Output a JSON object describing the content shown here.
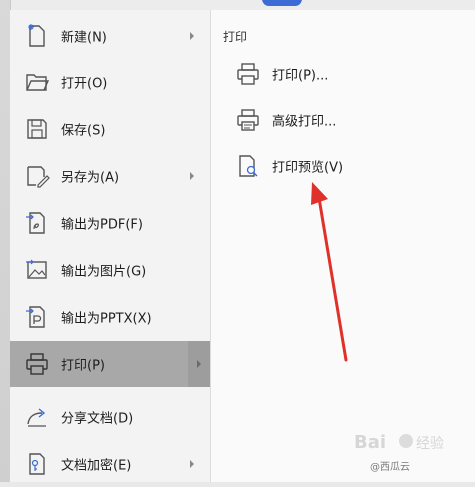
{
  "colors": {
    "menu_bg": "#f3f3f3",
    "active_bg": "#a8a8a8",
    "panel_bg": "#fafafa",
    "arrow": "#e0302a",
    "icon_stroke": "#555555",
    "accent_blue": "#3b6bd4"
  },
  "menu": {
    "items": [
      {
        "label": "新建(N)",
        "icon": "new-file-icon",
        "submenu": true
      },
      {
        "label": "打开(O)",
        "icon": "open-folder-icon",
        "submenu": false
      },
      {
        "label": "保存(S)",
        "icon": "save-icon",
        "submenu": false
      },
      {
        "label": "另存为(A)",
        "icon": "save-as-icon",
        "submenu": true
      },
      {
        "label": "输出为PDF(F)",
        "icon": "export-pdf-icon",
        "submenu": false
      },
      {
        "label": "输出为图片(G)",
        "icon": "export-image-icon",
        "submenu": false
      },
      {
        "label": "输出为PPTX(X)",
        "icon": "export-pptx-icon",
        "submenu": false
      },
      {
        "label": "打印(P)",
        "icon": "printer-icon",
        "submenu": true,
        "active": true
      },
      {
        "label": "分享文档(D)",
        "icon": "share-icon",
        "submenu": false
      },
      {
        "label": "文档加密(E)",
        "icon": "encrypt-icon",
        "submenu": true
      }
    ]
  },
  "panel": {
    "title": "打印",
    "items": [
      {
        "label": "打印(P)...",
        "icon": "printer-icon"
      },
      {
        "label": "高级打印...",
        "icon": "advanced-print-icon"
      },
      {
        "label": "打印预览(V)",
        "icon": "print-preview-icon"
      }
    ]
  },
  "watermark": {
    "text": "@西瓜云"
  }
}
